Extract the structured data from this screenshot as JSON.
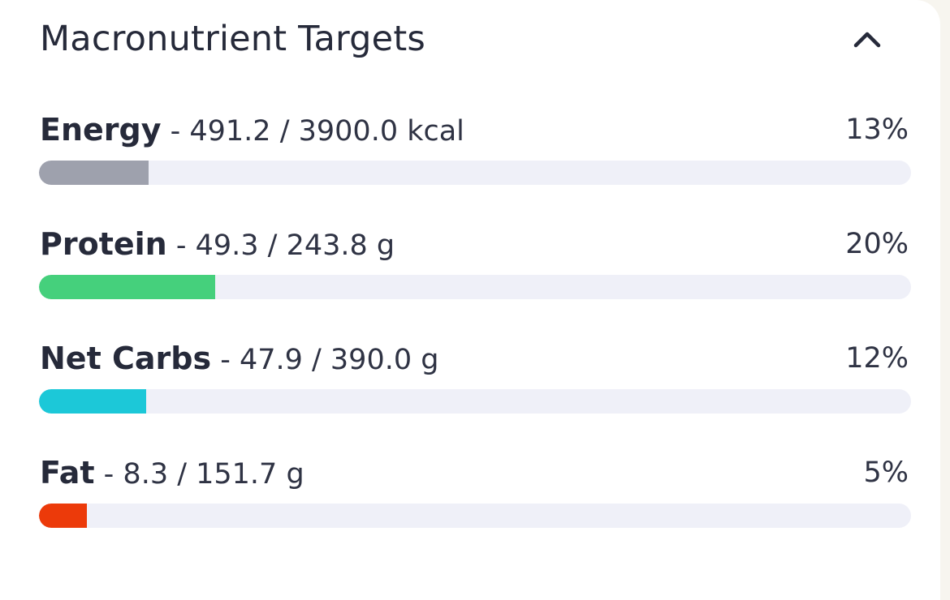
{
  "panel": {
    "title": "Macronutrient Targets",
    "collapse_icon": "chevron-up-icon"
  },
  "nutrients": [
    {
      "name": "Energy",
      "values": " - 491.2 / 3900.0 kcal",
      "percent_label": "13%",
      "progress": 0.126,
      "color": "#9ea1ad"
    },
    {
      "name": "Protein",
      "values": " - 49.3 / 243.8 g",
      "percent_label": "20%",
      "progress": 0.202,
      "color": "#45d07c"
    },
    {
      "name": "Net Carbs",
      "values": " - 47.9 / 390.0 g",
      "percent_label": "12%",
      "progress": 0.123,
      "color": "#1cc8d8"
    },
    {
      "name": "Fat",
      "values": " - 8.3 / 151.7 g",
      "percent_label": "5%",
      "progress": 0.055,
      "color": "#ec3a0a"
    }
  ]
}
